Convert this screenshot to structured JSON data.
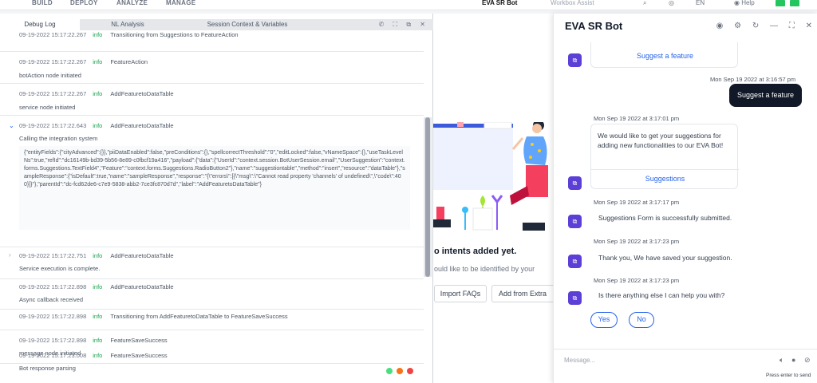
{
  "nav": {
    "items": [
      "BUILD",
      "DEPLOY",
      "ANALYZE",
      "MANAGE"
    ],
    "bot_name": "EVA SR Bot",
    "bot_sub": "Workbox Assist",
    "icons": [
      "search-icon",
      "help-circle-icon",
      "language-icon",
      "help-icon"
    ],
    "lang": "EN",
    "help": "Help"
  },
  "debug": {
    "tabs": [
      "Debug Log",
      "NL Analysis",
      "Session Context & Variables"
    ],
    "entries": [
      {
        "time": "09-19-2022 15:17:22.267",
        "level": "info",
        "event": "Transitioning from Suggestions to FeatureAction",
        "desc": ""
      },
      {
        "time": "09-19-2022 15:17:22.267",
        "level": "info",
        "event": "FeatureAction",
        "desc": "botAction node initiated"
      },
      {
        "time": "09-19-2022 15:17:22.267",
        "level": "info",
        "event": "AddFeaturetoDataTable",
        "desc": "service node initiated"
      },
      {
        "time": "09-19-2022 15:17:22.643",
        "level": "info",
        "event": "AddFeaturetoDataTable",
        "desc": "Calling the integration system"
      },
      {
        "time": "09-19-2022 15:17:22.751",
        "level": "info",
        "event": "AddFeaturetoDataTable",
        "desc": "Service execution is complete."
      },
      {
        "time": "09-19-2022 15:17:22.898",
        "level": "info",
        "event": "AddFeaturetoDataTable",
        "desc": "Async callback received"
      },
      {
        "time": "09-19-2022 15:17:22.898",
        "level": "info",
        "event": "Transitioning from AddFeaturetoDataTable to FeatureSaveSuccess",
        "desc": ""
      },
      {
        "time": "09-19-2022 15:17:22.898",
        "level": "info",
        "event": "FeatureSaveSuccess",
        "desc": "message node initiated"
      },
      {
        "time": "09-19-2022 15:17:23.008",
        "level": "info",
        "event": "FeatureSaveSuccess",
        "desc": "Bot response parsing"
      }
    ],
    "payload": "{\"entityFields\":{\"cityAdvanced\":{}},\"piiDataEnabled\":false,\"preConditions\":{},\"spellcorrectThreshold\":\"0\",\"editLocked\":false,\"vNameSpace\":{},\"useTaskLevelNs\":true,\"refId\":\"dc16149b-bd39-5b56-8e89-c0fbcf19a416\",\"payload\":{\"data\":{\"UserId\":\"context.session.BotUserSession.email\",\"UserSuggestion\":\"context.forms.Suggestions.TextField4\",\"Feature\":\"context.forms.Suggestions.RadioButton2\"},\"name\":\"suggestiontable\",\"method\":\"insert\",\"resource\":\"dataTable\"},\"sampleResponse\":{\"isDefault\":true,\"name\":\"sampleResponse\",\"response\":\"{\\\"errors\\\":[{\\\"msg\\\":\\\"Cannot read property 'channels' of undefined\\\",\\\"code\\\":400}]}\"},\"parentId\":\"dc-fcd62de6-c7e9-5838-abb2-7ce3fc870d7d\",\"label\":\"AddFeaturetoDataTable\"}",
    "status_colors": [
      "#4ade80",
      "#f97316",
      "#ef4444"
    ]
  },
  "center": {
    "title": "o intents added yet.",
    "subtitle": "ould like to be identified by your",
    "import_label": "Import FAQs",
    "extract_label": "Add from Extra"
  },
  "chat": {
    "title": "EVA SR Bot",
    "header_icons": [
      "record-icon",
      "gear-icon",
      "refresh-icon",
      "minimize-icon",
      "expand-icon",
      "close-icon"
    ],
    "suggest_link": "Suggest a feature",
    "user_ts": "Mon Sep 19 2022 at 3:16:57 pm",
    "user_msg": "Suggest a feature",
    "msg1_ts": "Mon Sep 19 2022 at 3:17:01 pm",
    "msg1_text": "We would like to get your suggestions for adding new functionalities to our EVA Bot!",
    "msg1_link": "Suggestions",
    "msg2_ts": "Mon Sep 19 2022 at 3:17:17 pm",
    "msg2_text": "Suggestions Form is successfully submitted.",
    "msg3_ts": "Mon Sep 19 2022 at 3:17:23 pm",
    "msg3_text": "Thank you, We have saved your suggestion.",
    "msg4_ts": "Mon Sep 19 2022 at 3:17:23 pm",
    "msg4_text": "Is there anything else I can help you with?",
    "yes_label": "Yes",
    "no_label": "No",
    "input_placeholder": "Message...",
    "hint": "Press enter to send"
  }
}
